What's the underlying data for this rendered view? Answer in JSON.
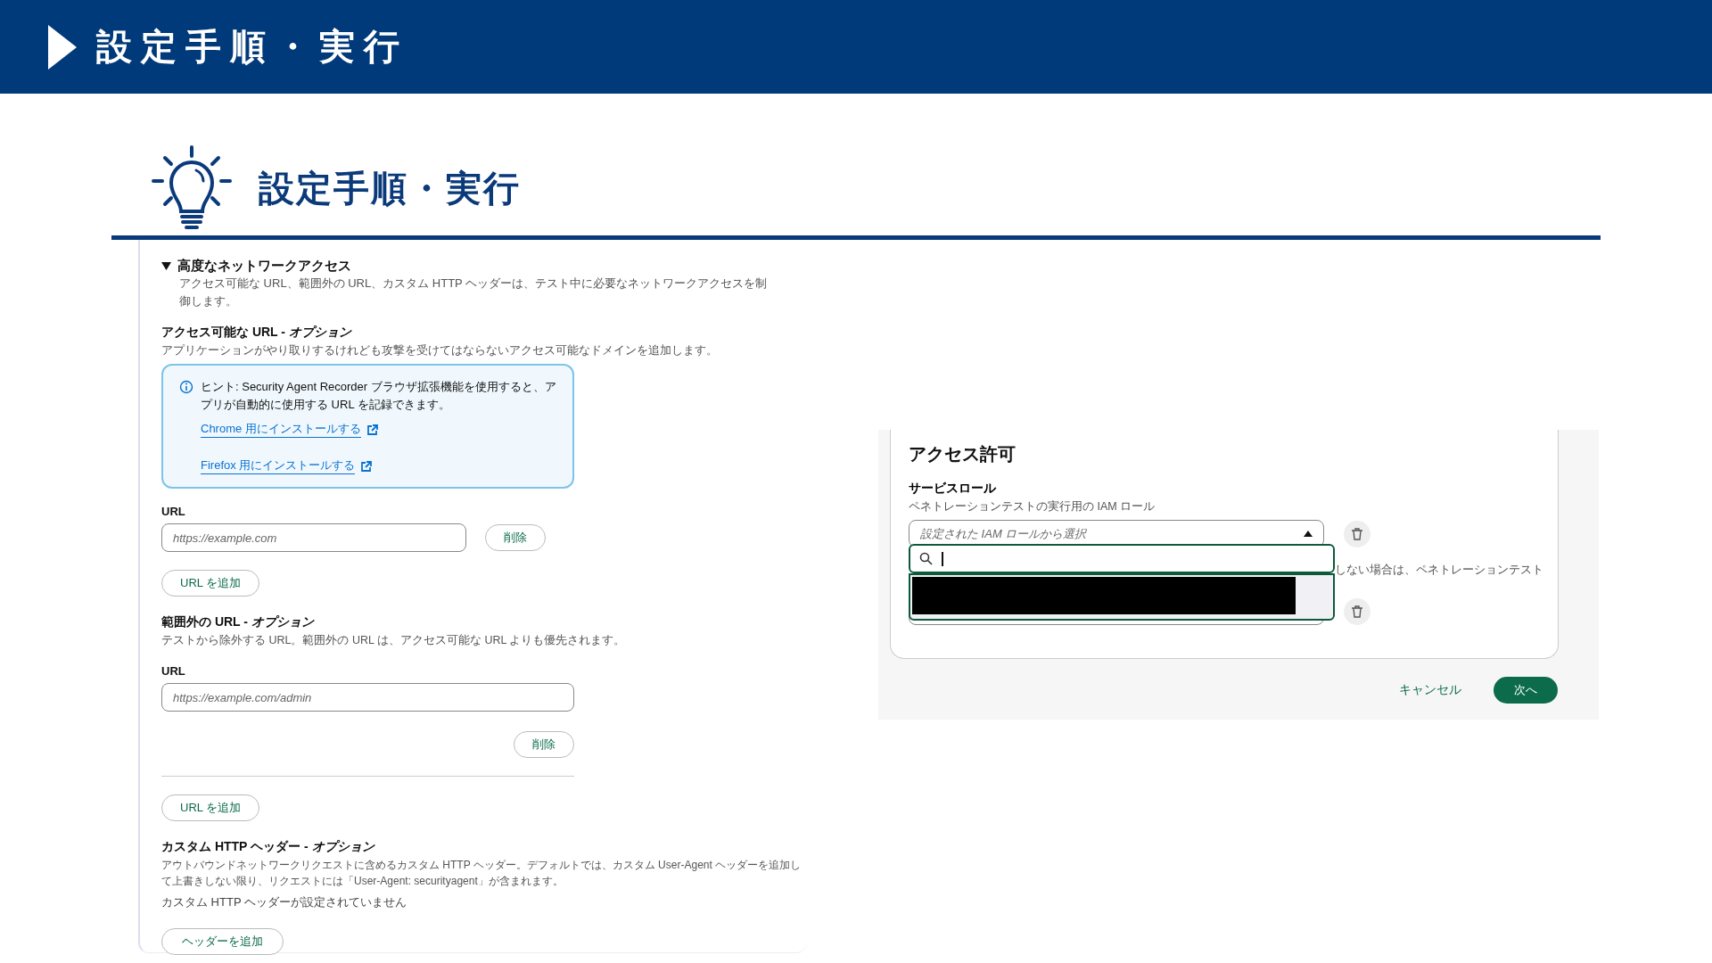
{
  "header": {
    "title": "設定手順・実行"
  },
  "section": {
    "title": "設定手順・実行"
  },
  "network": {
    "title": "高度なネットワークアクセス",
    "expanded": true,
    "description": "アクセス可能な URL、範囲外の URL、カスタム HTTP ヘッダーは、テスト中に必要なネットワークアクセスを制御します。",
    "accessible": {
      "title": "アクセス可能な URL - *オプション*",
      "description": "アプリケーションがやり取りするけれども攻撃を受けてはならないアクセス可能なドメインを追加します。",
      "hint": {
        "text": "ヒント: Security Agent Recorder ブラウザ拡張機能を使用すると、アプリが自動的に使用する URL を記録できます。",
        "links": [
          "Chrome 用にインストールする",
          "Firefox 用にインストールする"
        ]
      },
      "url_label": "URL",
      "placeholder": "https://example.com",
      "remove": "削除",
      "add": "URL を追加"
    },
    "excluded": {
      "title": "範囲外の URL - *オプション*",
      "description": "テストから除外する URL。範囲外の URL は、アクセス可能な URL よりも優先されます。",
      "url_label": "URL",
      "placeholder": "https://example.com/admin",
      "remove": "削除",
      "add": "URL を追加"
    },
    "headers": {
      "title": "カスタム HTTP ヘッダー - *オプション*",
      "description": "アウトバウンドネットワークリクエストに含めるカスタム HTTP ヘッダー。デフォルトでは、カスタム User-Agent ヘッダーを追加して上書きしない限り、リクエストには「User-Agent: securityagent」が含まれます。",
      "empty": "カスタム HTTP ヘッダーが設定されていません",
      "add": "ヘッダーを追加"
    }
  },
  "access": {
    "title": "アクセス許可",
    "role_label": "サービスロール",
    "role_description": "ペネトレーションテストの実行用の IAM ロール",
    "role_placeholder": "設定された IAM ロールから選択",
    "dropdown_open": true,
    "hidden_text": "しない場合は、ペネトレーションテスト",
    "cancel": "キャンセル",
    "next": "次へ"
  }
}
